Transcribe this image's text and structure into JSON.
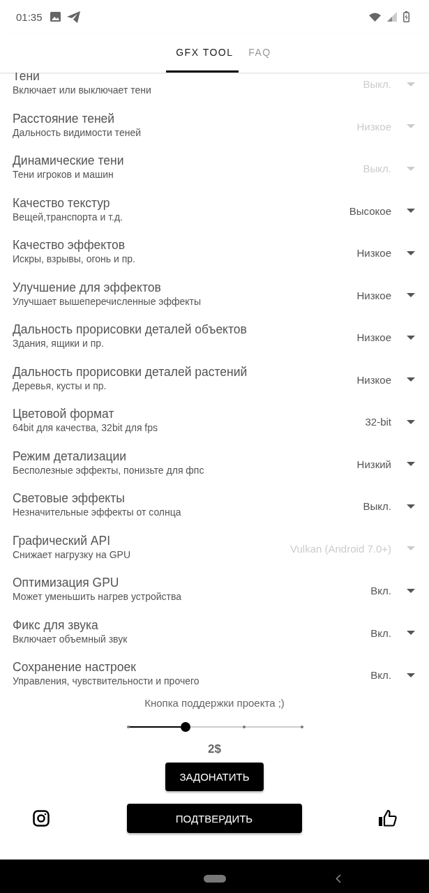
{
  "status_bar": {
    "time": "01:35"
  },
  "tabs": [
    {
      "label": "GFX TOOL",
      "selected": true
    },
    {
      "label": "FAQ",
      "selected": false
    }
  ],
  "settings": [
    {
      "title": "Тени",
      "subtitle": "Включает или выключает тени",
      "value": "Выкл.",
      "disabled": true
    },
    {
      "title": "Расстояние теней",
      "subtitle": "Дальность видимости теней",
      "value": "Низкое",
      "disabled": true
    },
    {
      "title": "Динамические тени",
      "subtitle": "Тени игроков и машин",
      "value": "Выкл.",
      "disabled": true
    },
    {
      "title": "Качество текстур",
      "subtitle": "Вещей,транспорта и т.д.",
      "value": "Высокое",
      "disabled": false
    },
    {
      "title": "Качество эффектов",
      "subtitle": "Искры, взрывы, огонь и пр.",
      "value": "Низкое",
      "disabled": false
    },
    {
      "title": "Улучшение для эффектов",
      "subtitle": "Улучшает вышеперечисленные эффекты",
      "value": "Низкое",
      "disabled": false
    },
    {
      "title": "Дальность прорисовки деталей объектов",
      "subtitle": "Здания, ящики и пр.",
      "value": "Низкое",
      "disabled": false
    },
    {
      "title": "Дальность прорисовки деталей растений",
      "subtitle": "Деревья, кусты и пр.",
      "value": "Низкое",
      "disabled": false
    },
    {
      "title": "Цветовой формат",
      "subtitle": "64bit для качества, 32bit для fps",
      "value": "32-bit",
      "disabled": false
    },
    {
      "title": "Режим детализации",
      "subtitle": "Бесполезные эффекты, понизьте для фпс",
      "value": "Низкий",
      "disabled": false
    },
    {
      "title": "Световые эффекты",
      "subtitle": "Незначительные эффекты от солнца",
      "value": "Выкл.",
      "disabled": false
    },
    {
      "title": "Графический API",
      "subtitle": "Снижает нагрузку на GPU",
      "value": "Vulkan (Android 7.0+)",
      "disabled": true
    },
    {
      "title": "Оптимизация GPU",
      "subtitle": "Может уменьшить нагрев устройства",
      "value": "Вкл.",
      "disabled": false
    },
    {
      "title": "Фикс для звука",
      "subtitle": "Включает объемный звук",
      "value": "Вкл.",
      "disabled": false
    },
    {
      "title": "Сохранение настроек",
      "subtitle": "Управления, чувствительности и прочего",
      "value": "Вкл.",
      "disabled": false
    }
  ],
  "donate": {
    "label": "Кнопка поддержки проекта ;)",
    "slider": {
      "level": 0.333
    },
    "amount": "2$",
    "button": "ЗАДОНАТИТЬ"
  },
  "confirm_button": "ПОДТВЕРДИТЬ"
}
